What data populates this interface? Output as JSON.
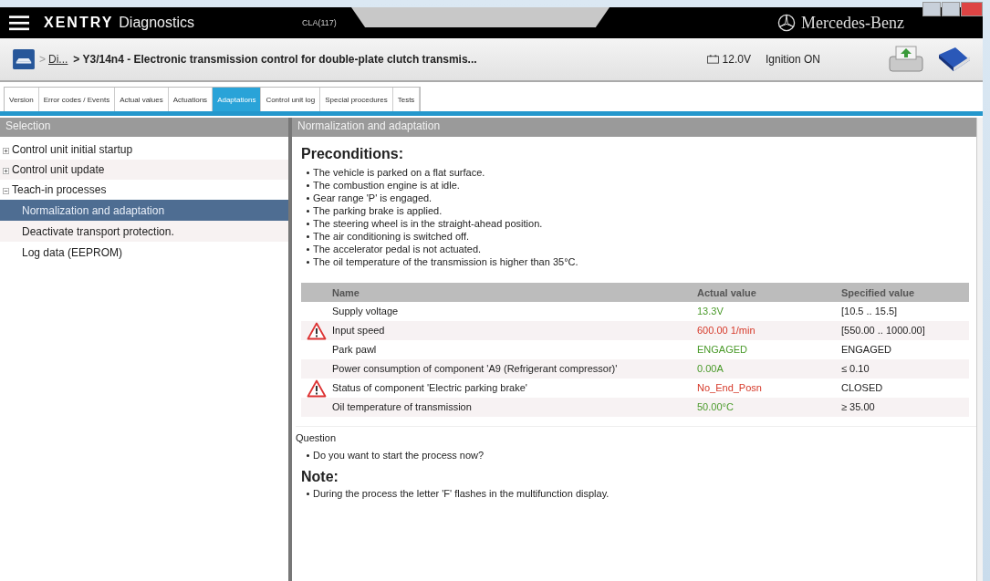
{
  "title_bar": {
    "brand": "XENTRY",
    "app": "Diagnostics",
    "vehicle": "CLA(117)",
    "maker": "Mercedes-Benz"
  },
  "breadcrumb": {
    "separator": ">",
    "link": "Di...",
    "path": "> Y3/14n4 - Electronic transmission control for double-plate clutch transmis...",
    "voltage": "12.0V",
    "ignition": "Ignition ON"
  },
  "tabs": [
    {
      "label": "Version",
      "selected": false
    },
    {
      "label": "Error codes / Events",
      "selected": false
    },
    {
      "label": "Actual values",
      "selected": false
    },
    {
      "label": "Actuations",
      "selected": false
    },
    {
      "label": "Adaptations",
      "selected": true
    },
    {
      "label": "Control unit log",
      "selected": false
    },
    {
      "label": "Special procedures",
      "selected": false
    },
    {
      "label": "Tests",
      "selected": false
    }
  ],
  "sidebar": {
    "title": "Selection",
    "items": [
      {
        "label": "Control unit initial startup",
        "expanded": false,
        "selected": false
      },
      {
        "label": "Control unit update",
        "expanded": false,
        "selected": false
      },
      {
        "label": "Teach-in processes",
        "expanded": true,
        "selected": false,
        "children": [
          {
            "label": "Normalization and adaptation",
            "selected": true
          },
          {
            "label": "Deactivate transport protection.",
            "selected": false
          },
          {
            "label": "Log data (EEPROM)",
            "selected": false
          }
        ]
      }
    ]
  },
  "content": {
    "title": "Normalization and adaptation",
    "preconditions_heading": "Preconditions:",
    "preconditions": [
      "The vehicle is parked on a flat surface.",
      "The combustion engine is at idle.",
      "Gear range 'P' is engaged.",
      "The parking brake is applied.",
      "The steering wheel is in the straight-ahead position.",
      "The air conditioning is switched off.",
      "The accelerator pedal is not actuated.",
      "The oil temperature of the transmission is higher than 35°C."
    ],
    "table": {
      "columns": [
        "Name",
        "Actual value",
        "Specified value"
      ],
      "rows": [
        {
          "name": "Supply voltage",
          "actual": "13.3V",
          "specified": "[10.5 .. 15.5]",
          "fault": false
        },
        {
          "name": "Input speed",
          "actual": "600.00 1/min",
          "specified": "[550.00 .. 1000.00]",
          "fault": true
        },
        {
          "name": "Park pawl",
          "actual": "ENGAGED",
          "specified": "ENGAGED",
          "fault": false
        },
        {
          "name": "Power consumption of component 'A9 (Refrigerant compressor)'",
          "actual": "0.00A",
          "specified": "≤ 0.10",
          "fault": false
        },
        {
          "name": "Status of component 'Electric parking brake'",
          "actual": "No_End_Posn",
          "specified": "CLOSED",
          "fault": true
        },
        {
          "name": "Oil temperature of transmission",
          "actual": "50.00°C",
          "specified": "≥ 35.00",
          "fault": false
        }
      ]
    },
    "question_label": "Question",
    "questions": [
      "Do you want to start the process now?"
    ],
    "note_heading": "Note:",
    "notes": [
      "During the process the letter 'F' flashes in the multifunction display."
    ]
  }
}
